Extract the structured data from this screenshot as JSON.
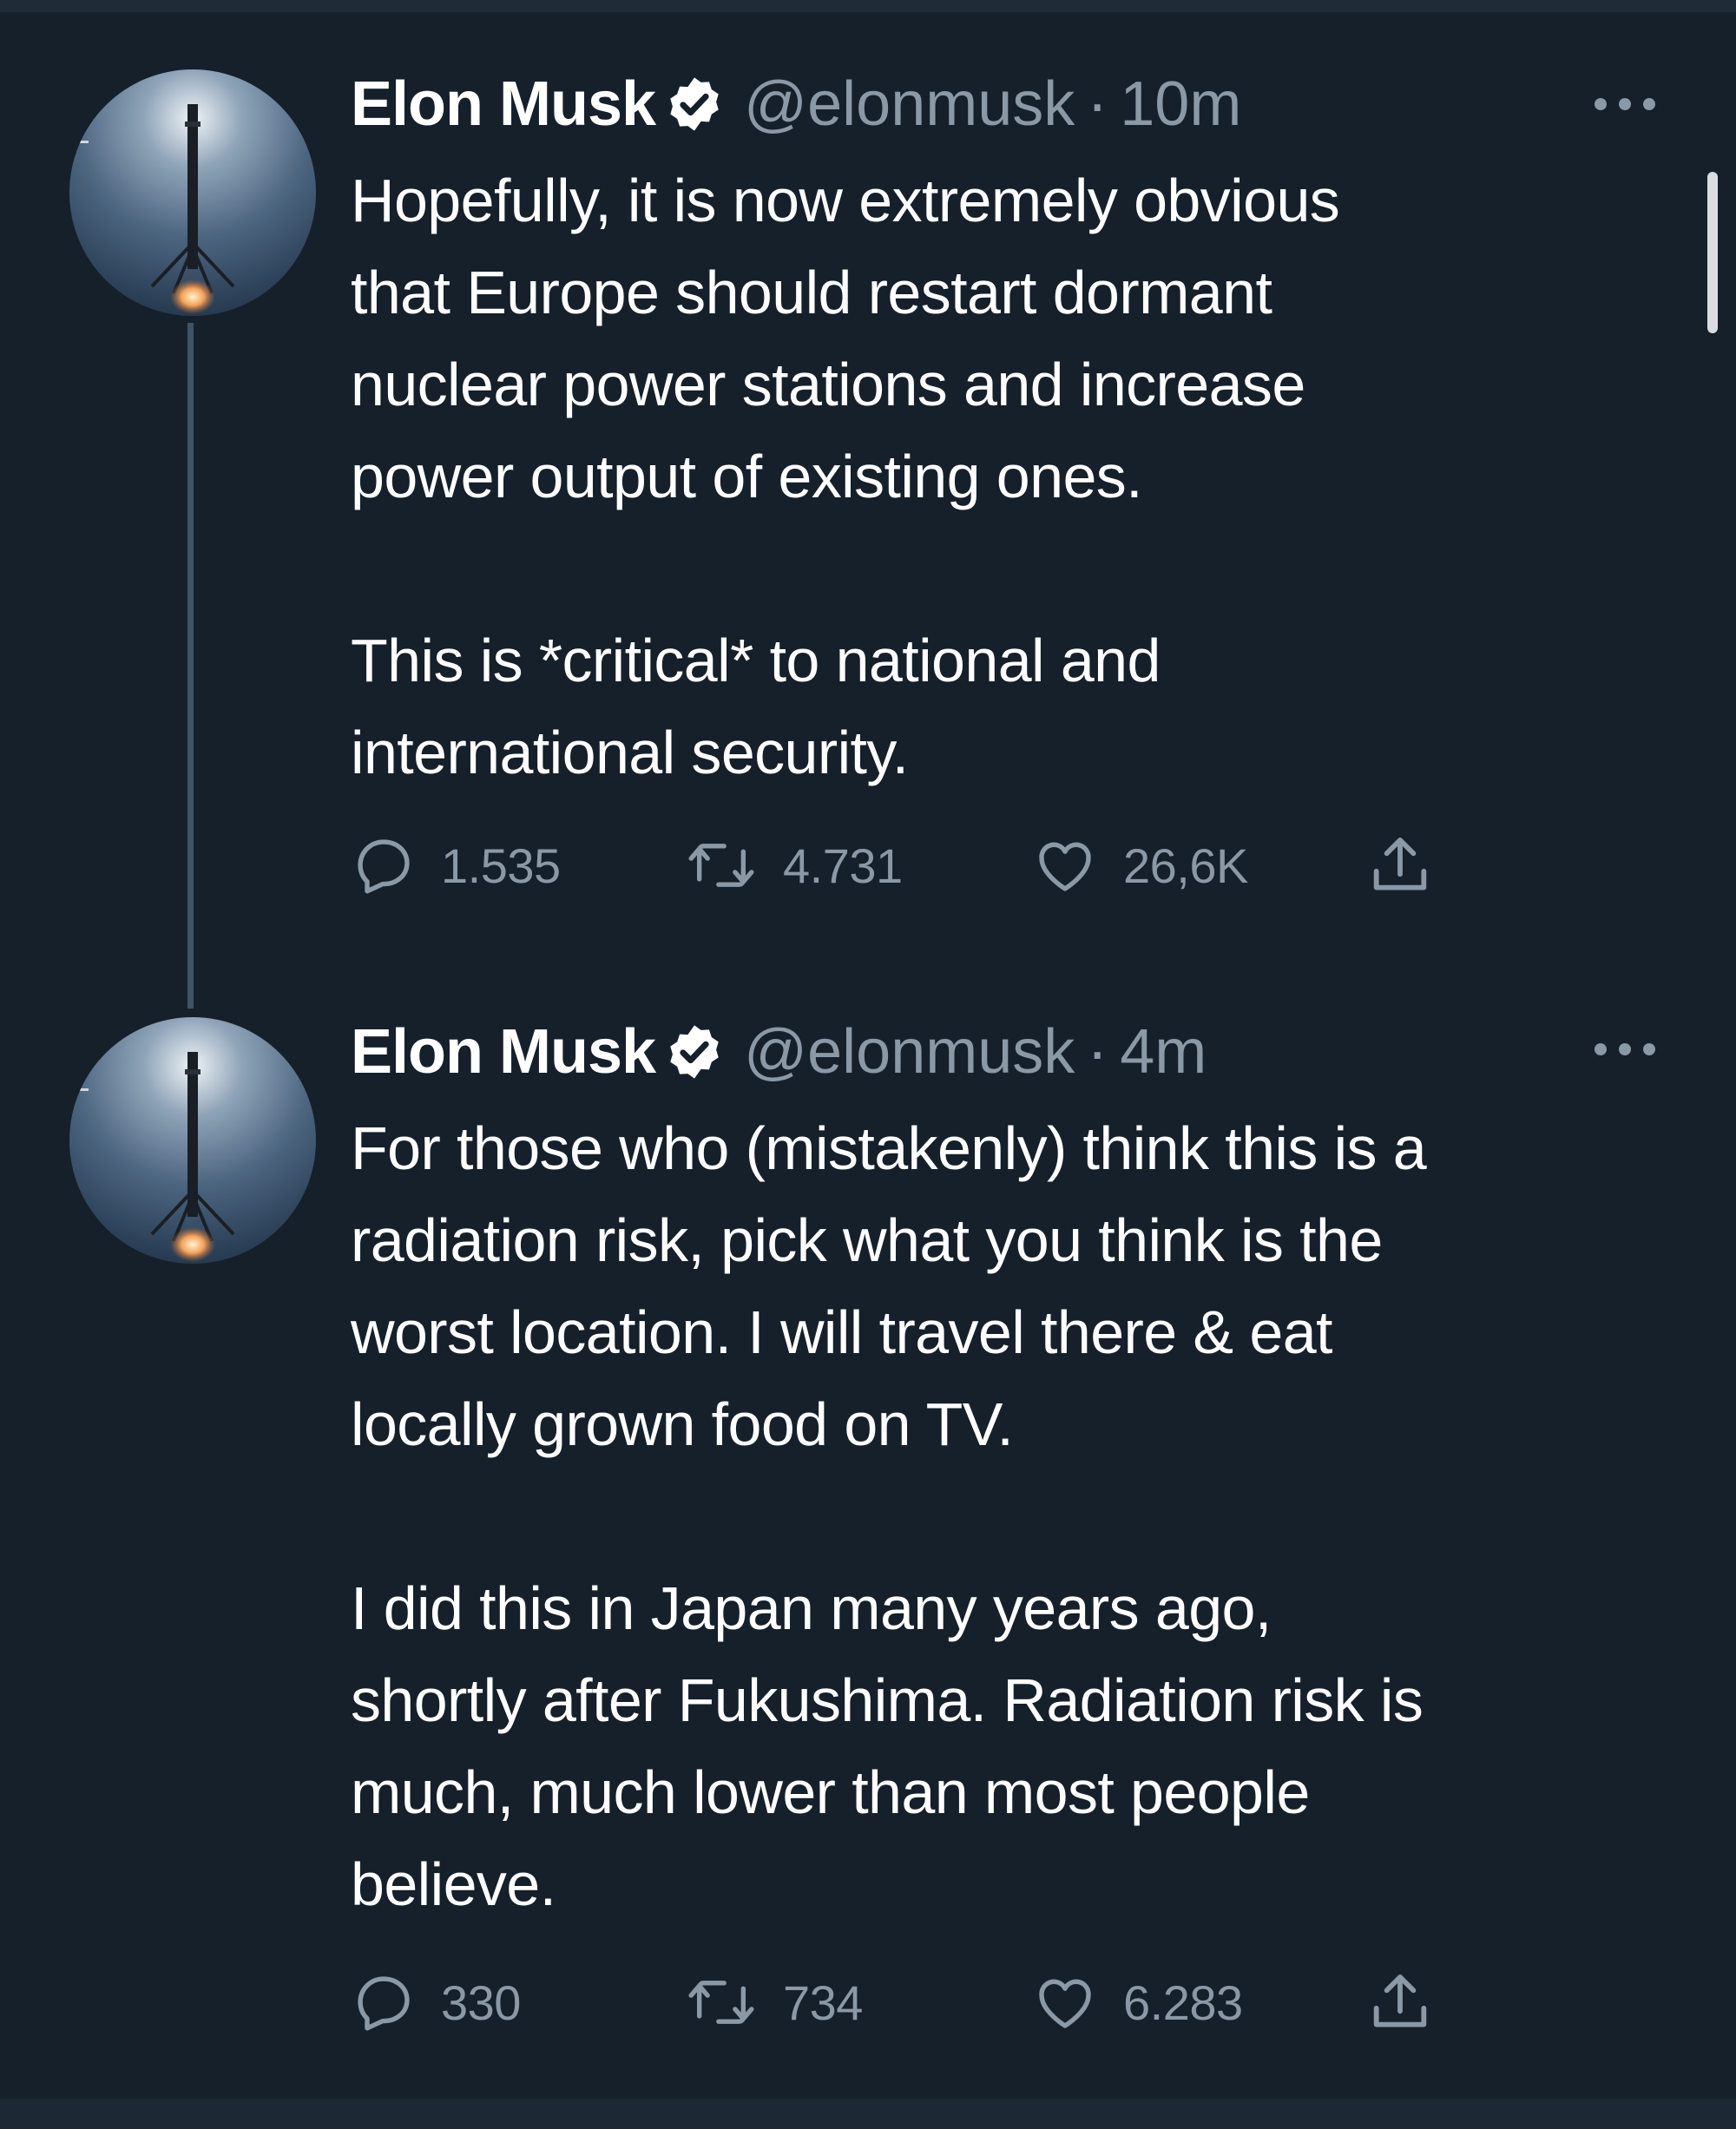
{
  "colors": {
    "background": "#15202b",
    "text_primary": "#ffffff",
    "text_secondary": "#8b98a5",
    "thread_line": "#3d5466"
  },
  "tweets": [
    {
      "author_name": "Elon Musk",
      "verified_icon": "verified-badge-icon",
      "handle": "@elonmusk",
      "separator": "·",
      "time": "10m",
      "more_icon": "more-options-icon",
      "paragraphs": [
        [
          "Hopefully, it is now extremely obvious",
          "that Europe should restart dormant",
          "nuclear power stations and increase",
          "power output of existing ones."
        ],
        [
          "This is *critical* to national and",
          "international security."
        ]
      ],
      "replies": "1.535",
      "retweets": "4.731",
      "likes": "26,6K"
    },
    {
      "author_name": "Elon Musk",
      "verified_icon": "verified-badge-icon",
      "handle": "@elonmusk",
      "separator": "·",
      "time": "4m",
      "more_icon": "more-options-icon",
      "paragraphs": [
        [
          "For those who (mistakenly) think this is a",
          "radiation risk, pick what you think is the",
          "worst location. I will travel there & eat",
          "locally grown food on TV."
        ],
        [
          "I did this in Japan many years ago,",
          "shortly after Fukushima. Radiation risk is",
          "much, much lower than most people",
          "believe."
        ]
      ],
      "replies": "330",
      "retweets": "734",
      "likes": "6.283"
    }
  ]
}
